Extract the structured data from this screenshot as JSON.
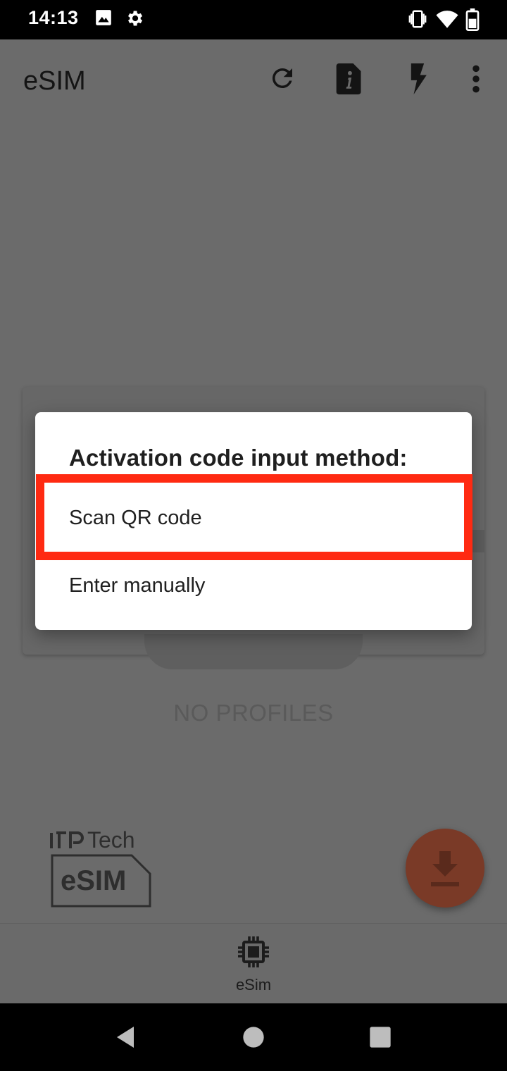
{
  "status_bar": {
    "time": "14:13"
  },
  "app_bar": {
    "title": "eSIM"
  },
  "dialog": {
    "title": "Activation code input method:",
    "options": [
      {
        "label": "Scan QR code"
      },
      {
        "label": "Enter manually"
      }
    ]
  },
  "main": {
    "empty_text": "NO PROFILES"
  },
  "brand": {
    "tech_text": "Tech",
    "esim_text": "eSIM"
  },
  "bottom_nav": {
    "items": [
      {
        "label": "eSim"
      }
    ]
  },
  "colors": {
    "highlight": "#ff2a12",
    "fab": "#7a3a27",
    "scrim": "#6b6b6b"
  },
  "icons": {
    "status": [
      "image-icon",
      "gear-icon",
      "vibrate-icon",
      "wifi-icon",
      "battery-icon"
    ],
    "toolbar": [
      "refresh-icon",
      "info-file-icon",
      "flash-icon",
      "more-vert-icon"
    ],
    "fab": "download-icon",
    "nav": "chip-icon",
    "system": [
      "back-icon",
      "home-icon",
      "recents-icon"
    ]
  }
}
